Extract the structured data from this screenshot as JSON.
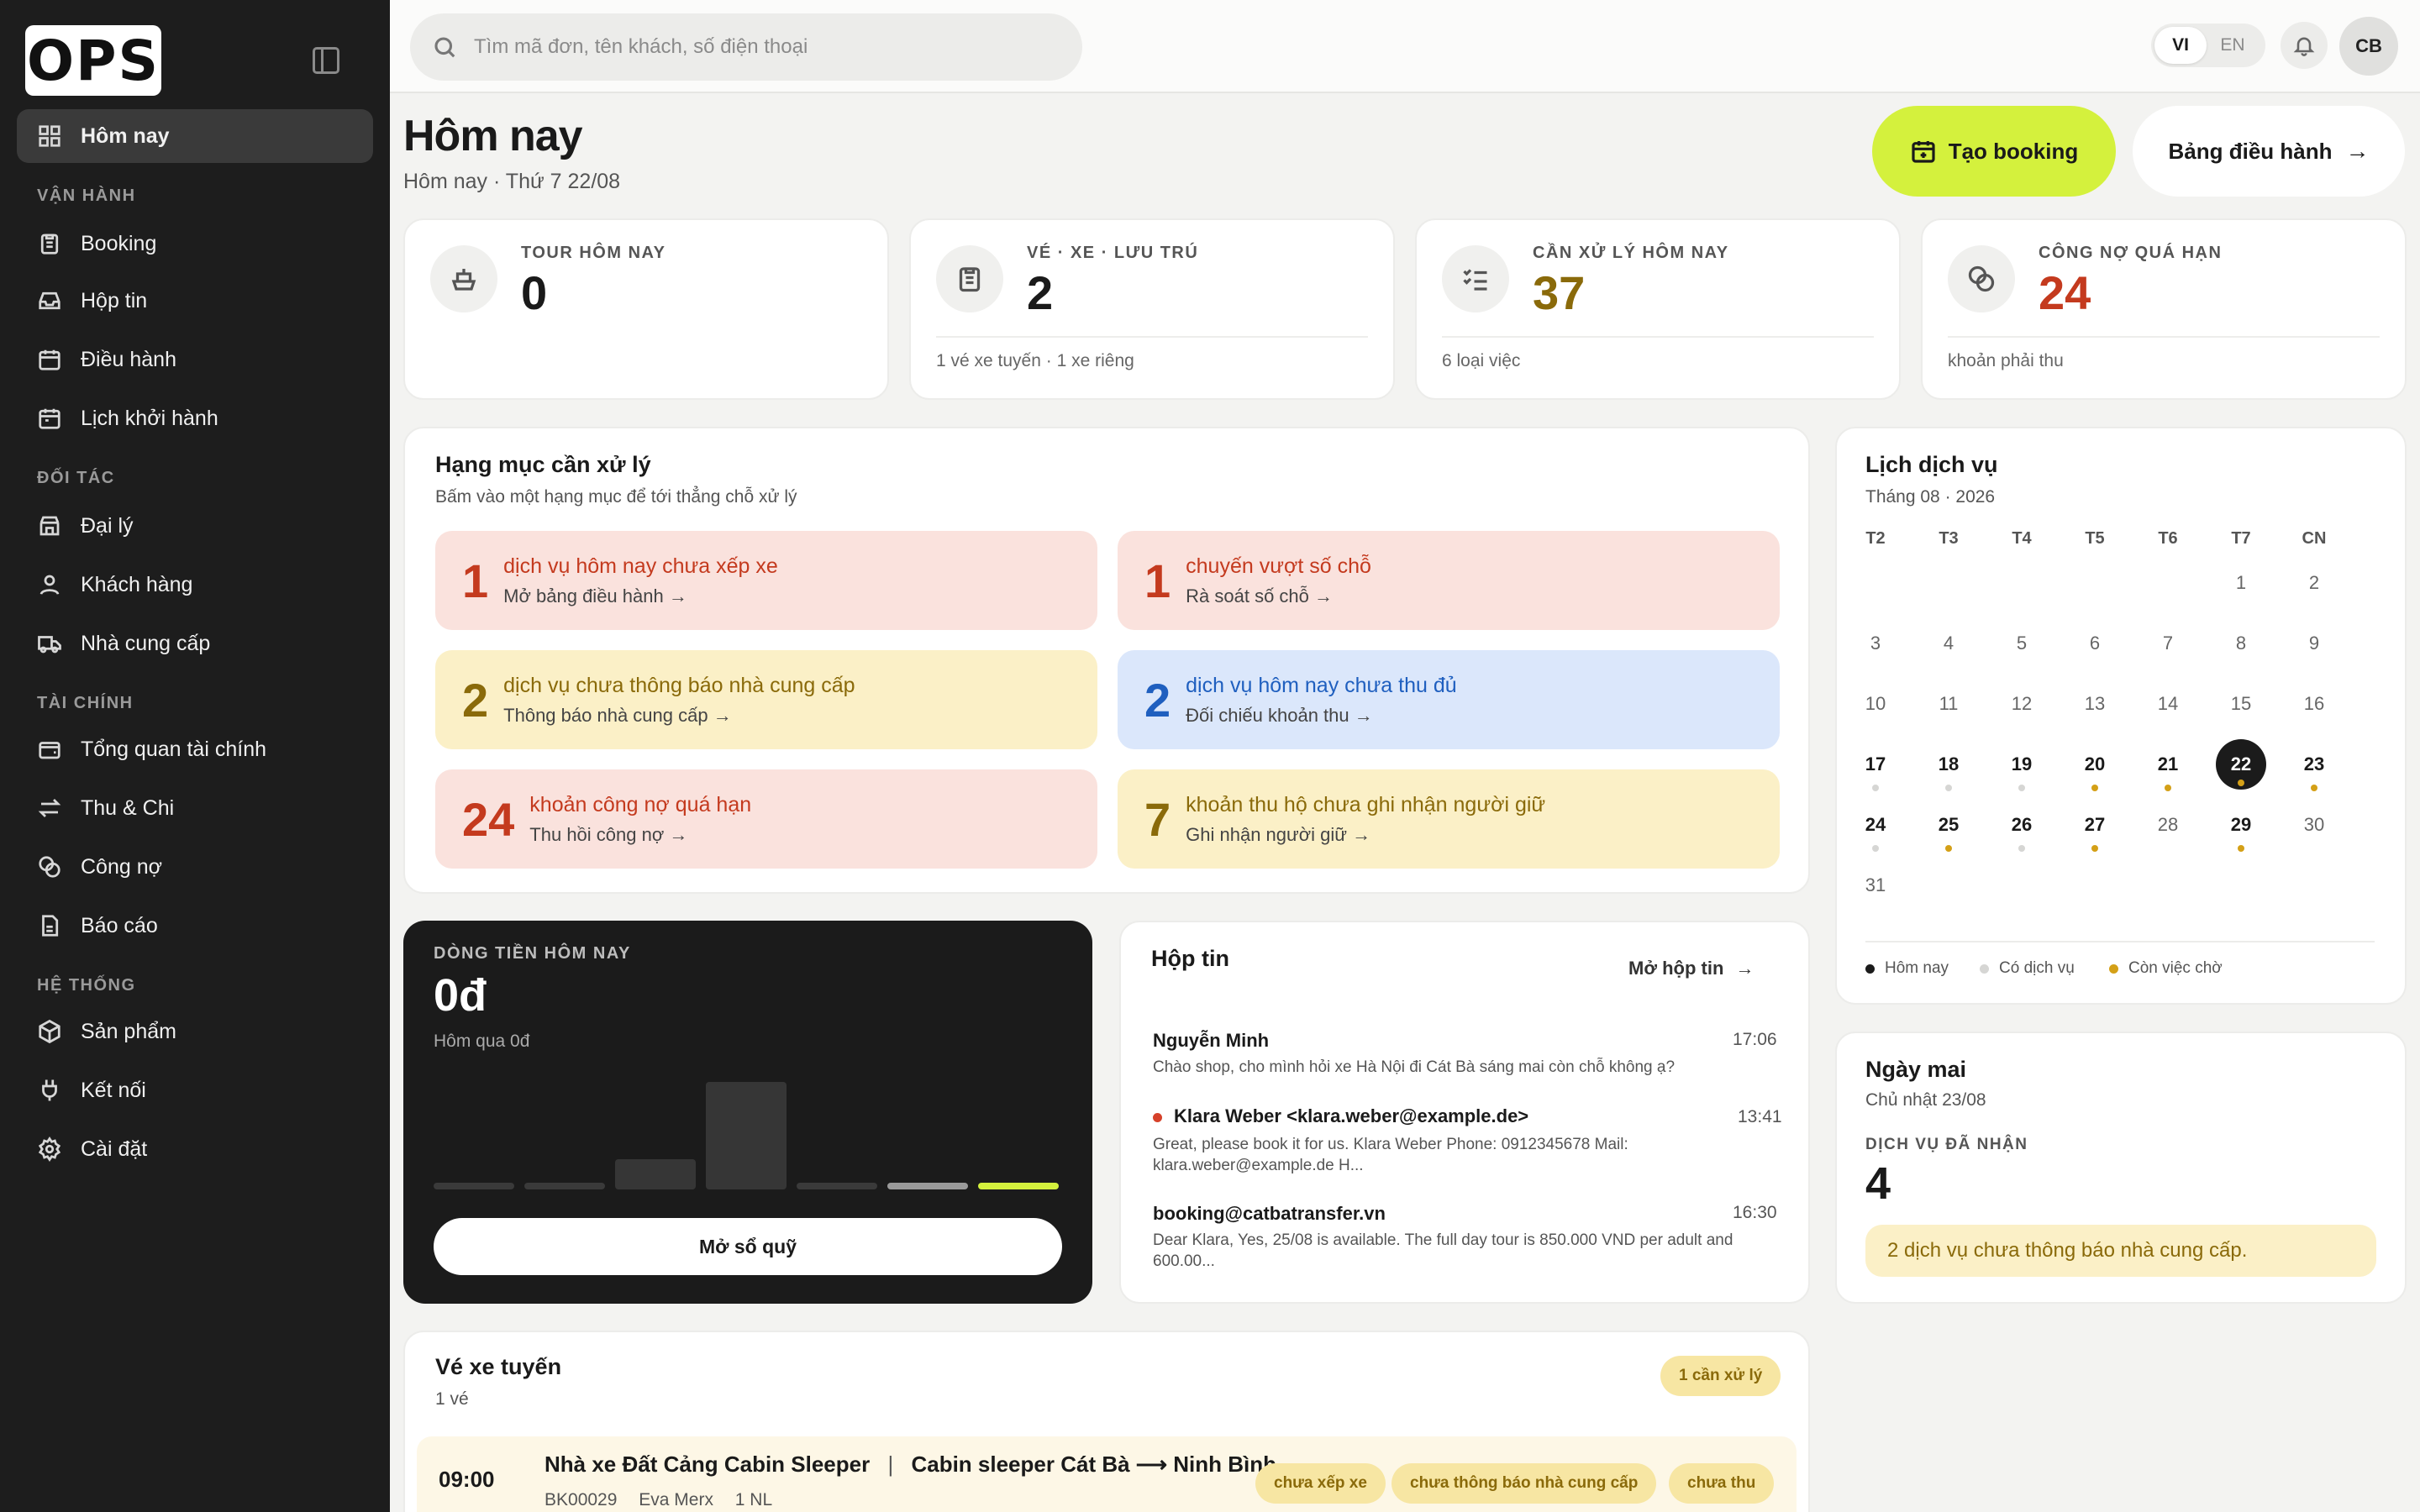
{
  "app": {
    "logo_text": "OPS"
  },
  "sidebar": {
    "items": [
      {
        "label": "Hôm nay",
        "icon": "grid-icon",
        "active": true
      },
      {
        "label": "Booking",
        "icon": "clipboard-icon"
      },
      {
        "label": "Hộp tin",
        "icon": "inbox-icon"
      },
      {
        "label": "Điều hành",
        "icon": "calendar-icon"
      },
      {
        "label": "Lịch khởi hành",
        "icon": "bus-icon"
      },
      {
        "label": "Đại lý",
        "icon": "store-icon"
      },
      {
        "label": "Khách hàng",
        "icon": "user-icon"
      },
      {
        "label": "Nhà cung cấp",
        "icon": "truck-icon"
      },
      {
        "label": "Tổng quan tài chính",
        "icon": "wallet-icon"
      },
      {
        "label": "Thu & Chi",
        "icon": "transfer-icon"
      },
      {
        "label": "Công nợ",
        "icon": "coins-icon"
      },
      {
        "label": "Báo cáo",
        "icon": "report-icon"
      },
      {
        "label": "Sản phẩm",
        "icon": "box-icon"
      },
      {
        "label": "Kết nối",
        "icon": "plug-icon"
      },
      {
        "label": "Cài đặt",
        "icon": "gear-icon"
      }
    ],
    "sections": [
      "VẬN HÀNH",
      "ĐỐI TÁC",
      "TÀI CHÍNH",
      "HỆ THỐNG"
    ]
  },
  "topbar": {
    "search_placeholder": "Tìm mã đơn, tên khách, số điện thoại",
    "lang_vi": "VI",
    "lang_en": "EN",
    "lang_selected": "VI",
    "avatar": "CB"
  },
  "header": {
    "title": "Hôm nay",
    "subtitle": "Hôm nay · Thứ 7 22/08",
    "create_label": "Tạo booking",
    "dashboard_label": "Bảng điều hành"
  },
  "kpis": [
    {
      "label": "TOUR HÔM NAY",
      "value": "0",
      "foot": "",
      "color": "#1a1a1a",
      "icon": "ship-icon"
    },
    {
      "label": "VÉ · XE · LƯU TRÚ",
      "value": "2",
      "foot": "1 vé xe tuyến · 1 xe riêng",
      "color": "#1a1a1a",
      "icon": "clipboard-icon"
    },
    {
      "label": "CẦN XỬ LÝ HÔM NAY",
      "value": "37",
      "foot": "6 loại việc",
      "color": "#8a6a0a",
      "icon": "checklist-icon"
    },
    {
      "label": "CÔNG NỢ QUÁ HẠN",
      "value": "24",
      "foot": "khoản phải thu",
      "color": "#c43a1e",
      "icon": "coins-icon"
    }
  ],
  "tasks": {
    "title": "Hạng mục cần xử lý",
    "subtitle": "Bấm vào một hạng mục để tới thẳng chỗ xử lý",
    "items": [
      {
        "num": "1",
        "text": "dịch vụ hôm nay chưa xếp xe",
        "action": "Mở bảng điều hành",
        "tone": "red"
      },
      {
        "num": "1",
        "text": "chuyến vượt số chỗ",
        "action": "Rà soát số chỗ",
        "tone": "red"
      },
      {
        "num": "2",
        "text": "dịch vụ chưa thông báo nhà cung cấp",
        "action": "Thông báo nhà cung cấp",
        "tone": "yellow"
      },
      {
        "num": "2",
        "text": "dịch vụ hôm nay chưa thu đủ",
        "action": "Đối chiếu khoản thu",
        "tone": "blue"
      },
      {
        "num": "24",
        "text": "khoản công nợ quá hạn",
        "action": "Thu hồi công nợ",
        "tone": "red"
      },
      {
        "num": "7",
        "text": "khoản thu hộ chưa ghi nhận người giữ",
        "action": "Ghi nhận người giữ",
        "tone": "yellow"
      }
    ]
  },
  "cashflow": {
    "label": "DÒNG TIỀN HÔM NAY",
    "value": "0đ",
    "sub": "Hôm qua 0đ",
    "button": "Mở sổ quỹ"
  },
  "inbox": {
    "title": "Hộp tin",
    "open_label": "Mở hộp tin",
    "messages": [
      {
        "from": "Nguyễn Minh",
        "time": "17:06",
        "body": "Chào shop, cho mình hỏi xe Hà Nội đi Cát Bà sáng mai còn chỗ không ạ?",
        "unread": false
      },
      {
        "from": "Klara Weber <klara.weber@example.de>",
        "time": "13:41",
        "body": "Great, please book it for us. Klara Weber Phone: 0912345678 Mail: klara.weber@example.de H...",
        "unread": true
      },
      {
        "from": "booking@catbatransfer.vn",
        "time": "16:30",
        "body": "Dear Klara, Yes, 25/08 is available. The full day tour is 850.000 VND per adult and 600.00...",
        "unread": false
      }
    ]
  },
  "calendar": {
    "title": "Lịch dịch vụ",
    "month": "Tháng 08 · 2026",
    "weekdays": [
      "T2",
      "T3",
      "T4",
      "T5",
      "T6",
      "T7",
      "CN"
    ],
    "legend": [
      "Hôm nay",
      "Có dịch vụ",
      "Còn việc chờ"
    ]
  },
  "tomorrow": {
    "title": "Ngày mai",
    "date": "Chủ nhật 23/08",
    "label": "DỊCH VỤ ĐÃ NHẬN",
    "value": "4",
    "note": "2 dịch vụ chưa thông báo nhà cung cấp."
  },
  "routes": {
    "title": "Vé xe tuyến",
    "count": "1 vé",
    "badge": "1 cần xử lý",
    "row": {
      "time": "09:00",
      "operator": "Nhà xe Đất Cảng Cabin Sleeper",
      "sep": "|",
      "route": "Cabin sleeper Cát Bà ⟶ Ninh Bình",
      "code": "BK00029",
      "customer": "Eva Merx",
      "pax": "1 NL",
      "tags": [
        "chưa xếp xe",
        "chưa thông báo nhà cung cấp",
        "chưa thu"
      ]
    }
  },
  "colors": {
    "accent": "#d4f13d",
    "sidebar": "#1d1d1d",
    "danger": "#c43a1e",
    "warning": "#8a6a0a",
    "info": "#1f5fbf"
  }
}
